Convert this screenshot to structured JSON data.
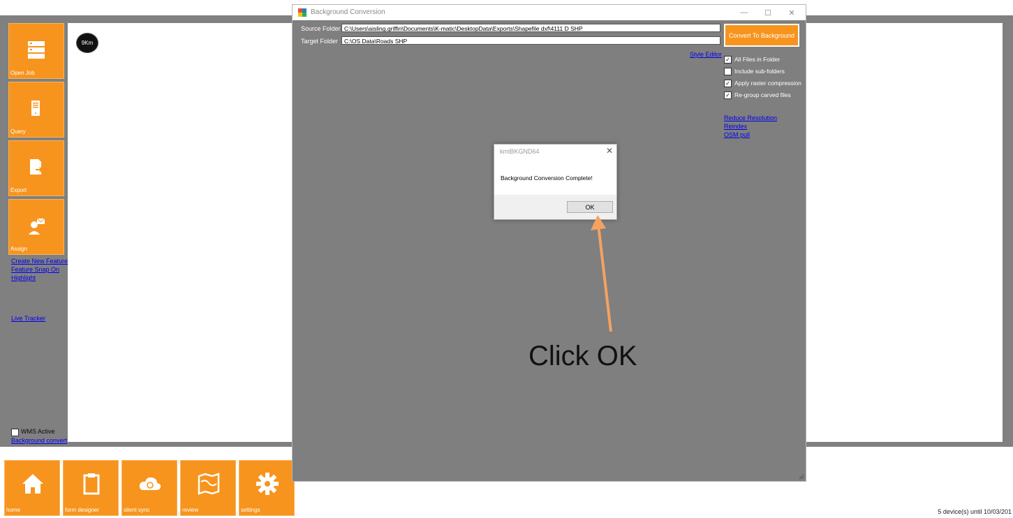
{
  "scale_badge": "9Km",
  "sidebar": {
    "tiles": [
      {
        "label": "Open Job",
        "icon": "server-icon"
      },
      {
        "label": "Query",
        "icon": "document-icon"
      },
      {
        "label": "Export",
        "icon": "export-icon"
      },
      {
        "label": "Assign",
        "icon": "assign-user-icon"
      }
    ],
    "links": [
      "Create New Feature",
      "Feature Snap On",
      "Highlight",
      "Live Tracker"
    ],
    "wms_active_label": "WMS Active",
    "wms_active_checked": false,
    "background_convert_link": "Background convert"
  },
  "bottom_tiles": [
    {
      "label": "home",
      "icon": "home-icon"
    },
    {
      "label": "form designer",
      "icon": "clipboard-icon"
    },
    {
      "label": "silent sync",
      "icon": "cloud-sync-icon"
    },
    {
      "label": "review",
      "icon": "map-icon"
    },
    {
      "label": "settings",
      "icon": "gear-icon"
    }
  ],
  "status": {
    "devices": "5 device(s) until 10/03/201"
  },
  "conversion_window": {
    "title": "Background Conversion",
    "controls": {
      "minimize": "—",
      "maximize": "☐",
      "close": "✕"
    },
    "source_label": "Source Folder",
    "source_value": "C:\\Users\\aisling.griffin\\Documents\\K-matic\\DesktopData\\Exports\\Shapefile dxf\\4111 D SHP",
    "target_label": "Target Folder",
    "target_value": "C:\\OS Data\\Roads SHP",
    "convert_button": "Convert To Background",
    "style_editor_link": "Style Editor",
    "options": [
      {
        "label": "All Files in Folder",
        "checked": true
      },
      {
        "label": "Include sub-folders",
        "checked": false
      },
      {
        "label": "Apply raster compression",
        "checked": true
      },
      {
        "label": "Re-group carved files",
        "checked": true
      }
    ],
    "links": [
      "Reduce Resolution",
      "Reindex",
      "OSM pull"
    ]
  },
  "message_box": {
    "title": "kmtBKGND64",
    "close": "✕",
    "text": "Background Conversion Complete!",
    "ok_label": "OK"
  },
  "callout": {
    "text": "Click OK",
    "arrow_color": "#f4a261"
  },
  "colors": {
    "accent": "#f7941d",
    "panel_gray": "#808080",
    "link": "#0000ee"
  }
}
